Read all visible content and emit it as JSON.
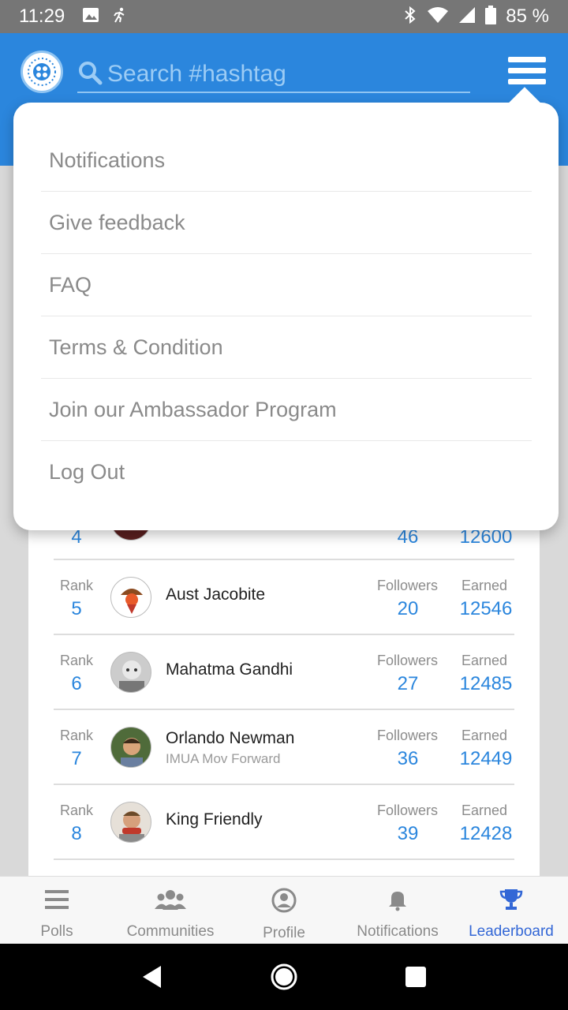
{
  "status_bar": {
    "time": "11:29",
    "battery": "85 %"
  },
  "header": {
    "search_placeholder": "Search #hashtag"
  },
  "menu": {
    "items": [
      "Notifications",
      "Give feedback",
      "FAQ",
      "Terms & Condition",
      "Join our Ambassador Program",
      "Log Out"
    ]
  },
  "leaderboard": {
    "partial_row": {
      "rank": "4",
      "followers": "46",
      "earned": "12600"
    },
    "rows": [
      {
        "rank_label": "Rank",
        "rank": "5",
        "name": "Aust Jacobite",
        "subtitle": "",
        "followers_label": "Followers",
        "followers": "20",
        "earned_label": "Earned",
        "earned": "12546"
      },
      {
        "rank_label": "Rank",
        "rank": "6",
        "name": "Mahatma Gandhi",
        "subtitle": "",
        "followers_label": "Followers",
        "followers": "27",
        "earned_label": "Earned",
        "earned": "12485"
      },
      {
        "rank_label": "Rank",
        "rank": "7",
        "name": "Orlando  Newman",
        "subtitle": "IMUA Mov Forward",
        "followers_label": "Followers",
        "followers": "36",
        "earned_label": "Earned",
        "earned": "12449"
      },
      {
        "rank_label": "Rank",
        "rank": "8",
        "name": "King Friendly",
        "subtitle": "",
        "followers_label": "Followers",
        "followers": "39",
        "earned_label": "Earned",
        "earned": "12428"
      }
    ]
  },
  "bottom_nav": {
    "items": [
      {
        "label": "Polls",
        "icon": "list-icon"
      },
      {
        "label": "Communities",
        "icon": "group-icon"
      },
      {
        "label": "Profile",
        "icon": "profile-icon"
      },
      {
        "label": "Notifications",
        "icon": "bell-icon"
      },
      {
        "label": "Leaderboard",
        "icon": "trophy-icon"
      }
    ],
    "active_index": 4
  },
  "colors": {
    "primary": "#2b86dd",
    "status_bar": "#767676",
    "active_nav": "#3367d6",
    "menu_text": "#8a8a8a"
  }
}
